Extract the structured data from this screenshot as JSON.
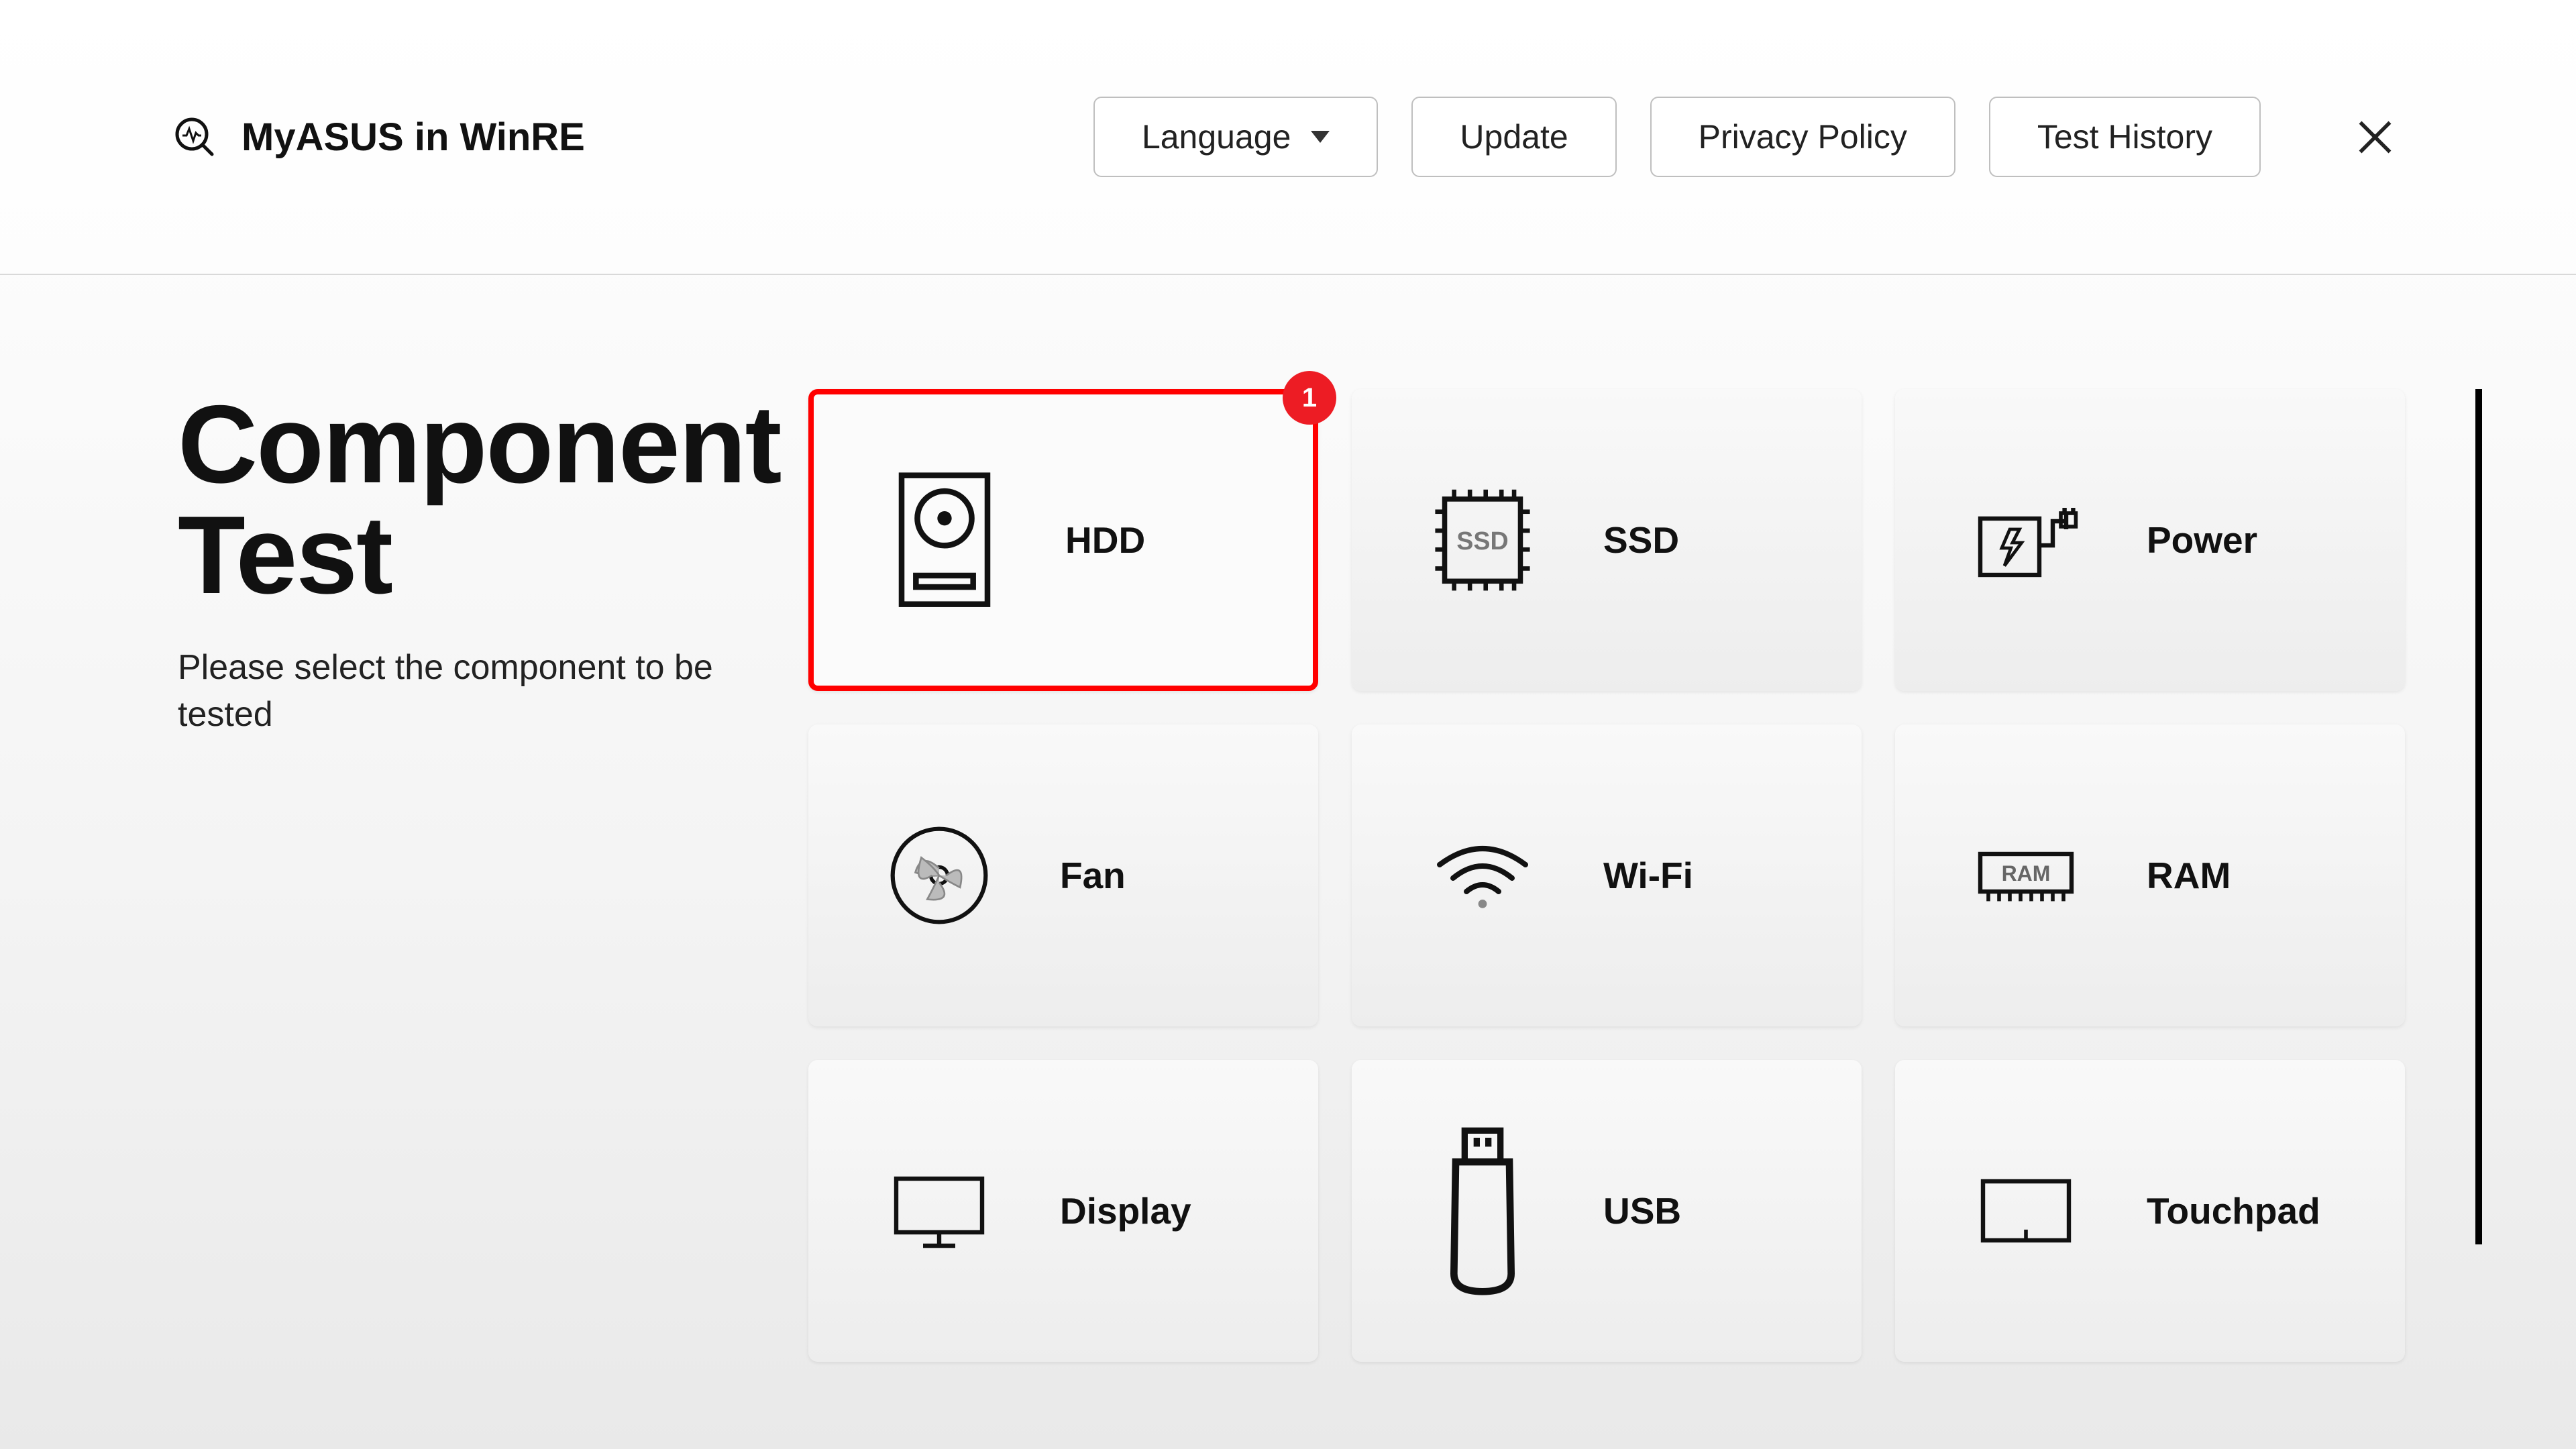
{
  "header": {
    "app_title": "MyASUS in WinRE",
    "language_label": "Language",
    "update_label": "Update",
    "privacy_label": "Privacy Policy",
    "history_label": "Test History"
  },
  "page": {
    "title_line1": "Component",
    "title_line2": "Test",
    "subtitle": "Please select the component to be tested"
  },
  "badge": {
    "hdd": "1"
  },
  "cards": {
    "hdd": {
      "label": "HDD"
    },
    "ssd": {
      "label": "SSD"
    },
    "power": {
      "label": "Power"
    },
    "fan": {
      "label": "Fan"
    },
    "wifi": {
      "label": "Wi-Fi"
    },
    "ram": {
      "label": "RAM"
    },
    "display": {
      "label": "Display"
    },
    "usb": {
      "label": "USB"
    },
    "touchpad": {
      "label": "Touchpad"
    }
  },
  "icon_text": {
    "ssd": "SSD",
    "ram": "RAM"
  },
  "colors": {
    "accent": "#ed1c24",
    "highlight_border": "#ff0000"
  }
}
